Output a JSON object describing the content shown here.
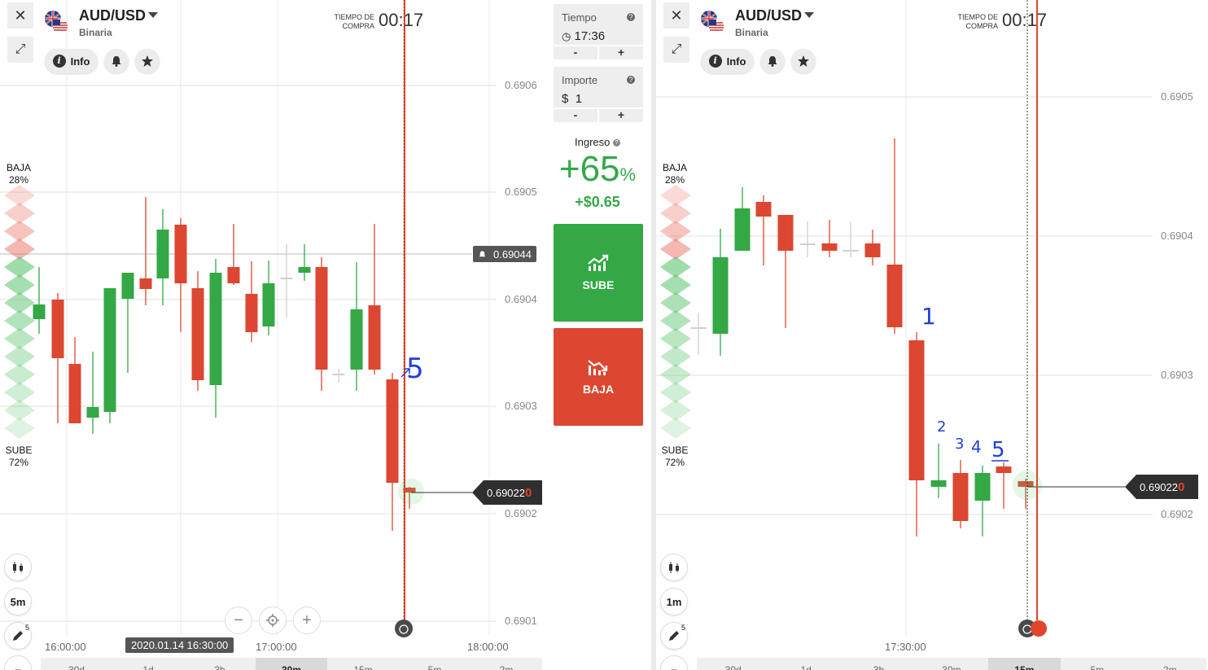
{
  "left": {
    "pair": "AUD/USD",
    "type": "Binaria",
    "info_label": "Info",
    "timer_label": "TIEMPO DE\nCOMPRA",
    "timer_value": "00:17",
    "baja_label": "BAJA",
    "baja_pct": "28%",
    "sube_label": "SUBE",
    "sube_pct": "72%",
    "timeframe": "5m",
    "draw_count": "5",
    "alert_price": "0.69044",
    "price_main": "0.69022",
    "price_last": "0",
    "cursor_time": "2020.01.14 16:30:00",
    "time_labels": [
      "16:00:00",
      "17:00:00",
      "18:00:00"
    ],
    "y_labels": [
      "0.6906",
      "0.6905",
      "0.6904",
      "0.6903",
      "0.6902",
      "0.6901"
    ],
    "periods": [
      "30d",
      "1d",
      "3h",
      "30m",
      "15m",
      "5m",
      "2m"
    ],
    "active_period": "30m",
    "annotation": "5"
  },
  "right": {
    "pair": "AUD/USD",
    "type": "Binaria",
    "info_label": "Info",
    "timer_label": "TIEMPO DE\nCOMPRA",
    "timer_value": "00:17",
    "baja_label": "BAJA",
    "baja_pct": "28%",
    "sube_label": "SUBE",
    "sube_pct": "72%",
    "timeframe": "1m",
    "draw_count": "5",
    "price_main": "0.69022",
    "price_last": "0",
    "time_labels": [
      "17:30:00"
    ],
    "y_labels": [
      "0.6905",
      "0.6904",
      "0.6903",
      "0.6902"
    ],
    "periods": [
      "30d",
      "1d",
      "3h",
      "30m",
      "15m",
      "5m",
      "2m"
    ],
    "active_period": "15m",
    "annotations": [
      "1",
      "2",
      "3",
      "4",
      "5"
    ]
  },
  "trade": {
    "time_label": "Tiempo",
    "time_value": "17:36",
    "amount_label": "Importe",
    "amount_value": "1",
    "currency": "$",
    "minus": "-",
    "plus": "+",
    "income_label": "Ingreso",
    "income_pct": "+65",
    "income_pct_sign": "%",
    "income_amount": "+$0.65",
    "sube_label": "SUBE",
    "baja_label": "BAJA"
  },
  "colors": {
    "up": "#33a844",
    "down": "#db4731",
    "expiry_line": "#e0452f"
  },
  "icons": [
    "close-icon",
    "expand-icon",
    "info-icon",
    "bell-icon",
    "star-icon",
    "clock-icon",
    "help-icon",
    "chart-type-icon",
    "pencil-icon",
    "zoom-out-icon",
    "target-icon",
    "zoom-in-icon",
    "stopwatch-icon",
    "trend-up-icon",
    "trend-down-icon"
  ]
}
